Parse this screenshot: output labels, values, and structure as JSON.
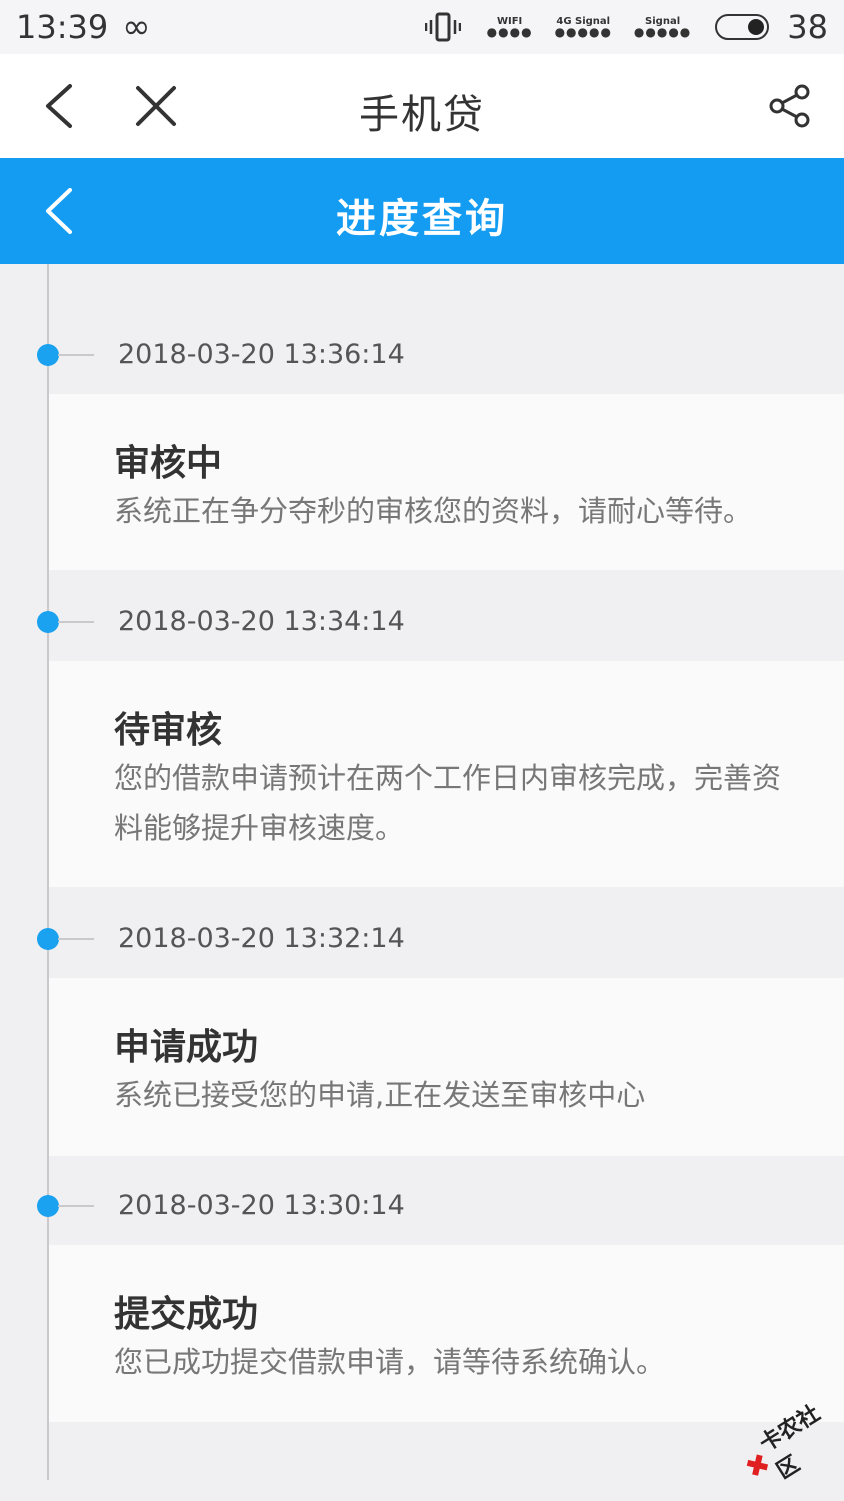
{
  "status_bar": {
    "time": "13:39",
    "loop_icon": "∞",
    "wifi_label": "WIFI",
    "signal1_label": "4G Signal",
    "signal2_label": "Signal",
    "dots": "●●●●",
    "dots5": "●●●●●",
    "battery_level": "38"
  },
  "title_bar": {
    "title": "手机贷"
  },
  "header": {
    "title": "进度查询"
  },
  "timeline": [
    {
      "date": "2018-03-20 13:36:14",
      "title": "审核中",
      "desc": "系统正在争分夺秒的审核您的资料，请耐心等待。"
    },
    {
      "date": "2018-03-20 13:34:14",
      "title": "待审核",
      "desc": "您的借款申请预计在两个工作日内审核完成，完善资料能够提升审核速度。"
    },
    {
      "date": "2018-03-20 13:32:14",
      "title": "申请成功",
      "desc": "系统已接受您的申请,正在发送至审核中心"
    },
    {
      "date": "2018-03-20 13:30:14",
      "title": "提交成功",
      "desc": "您已成功提交借款申请，请等待系统确认。"
    }
  ],
  "watermark": {
    "text": "卡农社区"
  },
  "colors": {
    "accent": "#139cf1",
    "dot": "#1aa1ef"
  }
}
